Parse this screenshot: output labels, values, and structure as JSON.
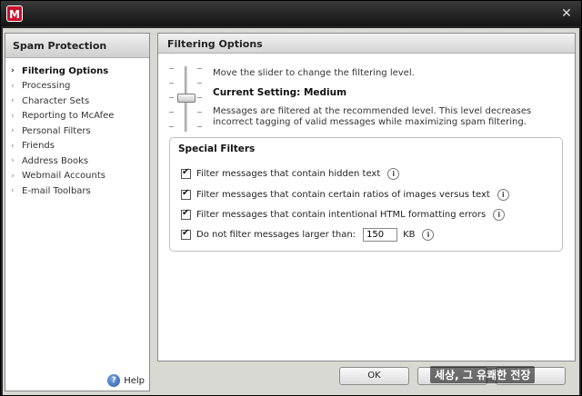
{
  "window": {
    "app_icon_letter": "M",
    "close_glyph": "✕"
  },
  "sidebar": {
    "title": "Spam Protection",
    "items": [
      {
        "label": "Filtering Options",
        "active": true
      },
      {
        "label": "Processing",
        "active": false
      },
      {
        "label": "Character Sets",
        "active": false
      },
      {
        "label": "Reporting to McAfee",
        "active": false
      },
      {
        "label": "Personal Filters",
        "active": false
      },
      {
        "label": "Friends",
        "active": false
      },
      {
        "label": "Address Books",
        "active": false
      },
      {
        "label": "Webmail Accounts",
        "active": false
      },
      {
        "label": "E-mail Toolbars",
        "active": false
      }
    ],
    "help_label": "Help",
    "help_icon": "question-icon"
  },
  "main": {
    "title": "Filtering Options",
    "slider": {
      "instruction": "Move the slider to change the filtering level.",
      "current_setting": "Current Setting: Medium",
      "description": "Messages are filtered at the recommended level. This level decreases incorrect tagging of valid messages while maximizing spam filtering."
    },
    "special_filters": {
      "title": "Special Filters",
      "filters": [
        {
          "label": "Filter messages that contain hidden text",
          "checked": true
        },
        {
          "label": "Filter messages that contain certain ratios of images versus text",
          "checked": true
        },
        {
          "label": "Filter messages that contain intentional HTML formatting errors",
          "checked": true
        },
        {
          "label": "Do not filter messages larger than:",
          "checked": true
        }
      ],
      "size_value": "150",
      "size_unit": "KB"
    }
  },
  "buttons": {
    "ok": "OK"
  },
  "watermark": "세상, 그 유쾌한 전장"
}
